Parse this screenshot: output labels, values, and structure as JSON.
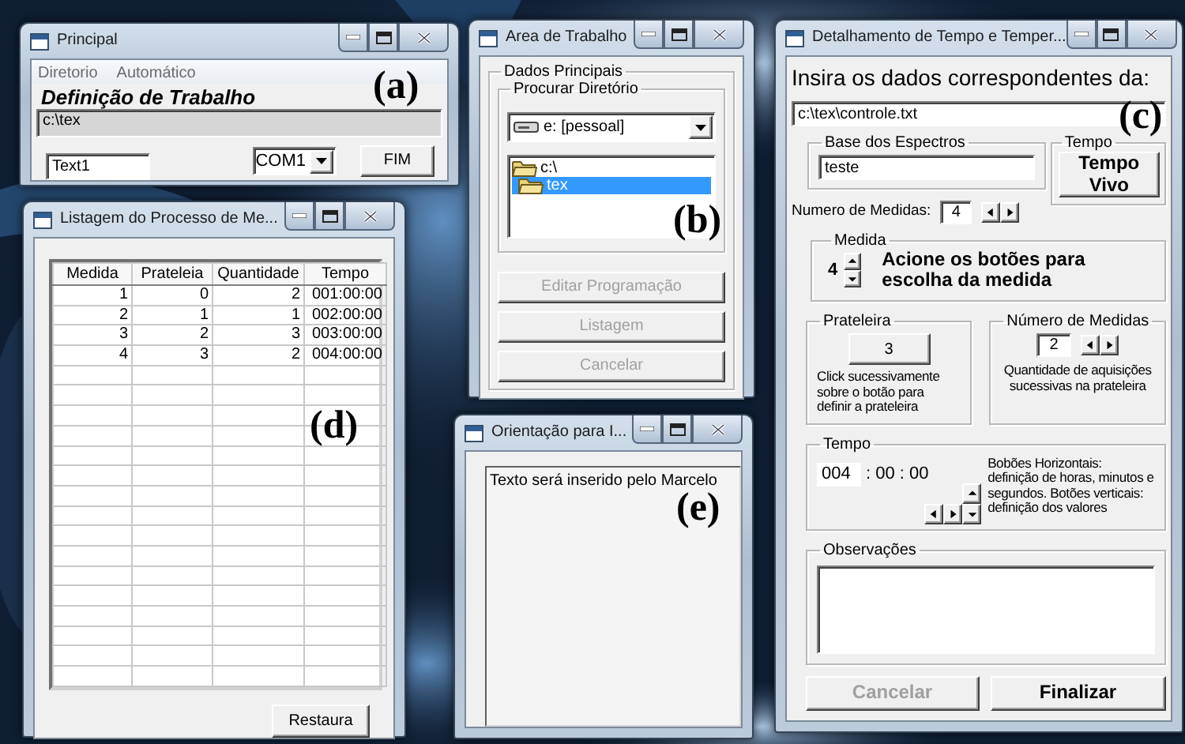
{
  "principal": {
    "title": "Principal",
    "annotation": "(a)",
    "menu": [
      "Diretorio",
      "Automático"
    ],
    "heading": "Definição de Trabalho",
    "path": "c:\\tex",
    "text_field": "Text1",
    "port": "COM1",
    "button": "FIM"
  },
  "listagem": {
    "title": "Listagem do Processo de Me...",
    "annotation": "(d)",
    "columns": [
      "Medida",
      "Prateleia",
      "Quantidade",
      "Tempo"
    ],
    "rows": [
      [
        "1",
        "0",
        "2",
        "001:00:00"
      ],
      [
        "2",
        "1",
        "1",
        "002:00:00"
      ],
      [
        "3",
        "2",
        "3",
        "003:00:00"
      ],
      [
        "4",
        "3",
        "2",
        "004:00:00"
      ]
    ],
    "button": "Restaura"
  },
  "area": {
    "title": "Area de Trabalho",
    "annotation": "(b)",
    "group": "Dados Principais",
    "subgroup": "Procurar Diretório",
    "drive": "e: [pessoal]",
    "folders": [
      {
        "name": "c:\\",
        "selected": false
      },
      {
        "name": "tex",
        "selected": true
      }
    ],
    "buttons": [
      {
        "label": "Editar Programação",
        "disabled": true
      },
      {
        "label": "Listagem",
        "disabled": true
      },
      {
        "label": "Cancelar",
        "disabled": true
      }
    ]
  },
  "orientacao": {
    "title": "Orientação para I...",
    "annotation": "(e)",
    "text": "Texto será inserido pelo Marcelo"
  },
  "detalhamento": {
    "title": "Detalhamento de Tempo e Temper...",
    "annotation": "(c)",
    "heading": "Insira os dados correspondentes da:",
    "path": "c:\\tex\\controle.txt",
    "base": {
      "legend": "Base dos Espectros",
      "value": "teste"
    },
    "tempo_vivo": {
      "legend": "Tempo",
      "button": "Tempo Vivo"
    },
    "medidas": {
      "label": "Numero de Medidas:",
      "value": "4"
    },
    "medida": {
      "legend": "Medida",
      "value": "4",
      "instruction": "Acione os botões para escolha da medida"
    },
    "prateleira": {
      "legend": "Prateleira",
      "button": "3",
      "note": "Click sucessivamente sobre o botão para definir a prateleira"
    },
    "numero": {
      "legend": "Número de Medidas",
      "value": "2",
      "note": "Quantidade de aquisições sucessivas na prateleira"
    },
    "tempo": {
      "legend": "Tempo",
      "hours": "004",
      "rest": ": 00 : 00",
      "help": "Bobões Horizontais: definição de horas, minutos e segundos. Botões verticais: definição dos valores"
    },
    "observacoes": {
      "legend": "Observações"
    },
    "buttons": [
      {
        "label": "Cancelar",
        "disabled": true
      },
      {
        "label": "Finalizar",
        "disabled": false
      }
    ]
  }
}
